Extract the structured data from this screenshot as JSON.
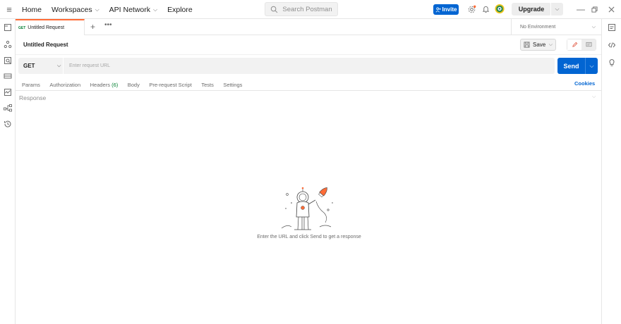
{
  "topbar": {
    "nav": [
      {
        "label": "Home",
        "has_chevron": false
      },
      {
        "label": "Workspaces",
        "has_chevron": true
      },
      {
        "label": "API Network",
        "has_chevron": true
      },
      {
        "label": "Explore",
        "has_chevron": false
      }
    ],
    "search_placeholder": "Search Postman",
    "invite_label": "Invite",
    "upgrade_label": "Upgrade",
    "brand_color": "#ff6c37",
    "accent_color": "#0265d2"
  },
  "tabs": {
    "items": [
      {
        "method": "GET",
        "title": "Untitled Request",
        "active": true
      }
    ],
    "environment": "No Environment"
  },
  "request": {
    "title": "Untitled Request",
    "save_label": "Save",
    "method": "GET",
    "url_placeholder": "Enter request URL",
    "url_value": "",
    "send_label": "Send",
    "subtabs": [
      {
        "label": "Params",
        "count": ""
      },
      {
        "label": "Authorization",
        "count": ""
      },
      {
        "label": "Headers",
        "count": "(6)"
      },
      {
        "label": "Body",
        "count": ""
      },
      {
        "label": "Pre-request Script",
        "count": ""
      },
      {
        "label": "Tests",
        "count": ""
      },
      {
        "label": "Settings",
        "count": ""
      }
    ],
    "cookies_label": "Cookies"
  },
  "response": {
    "label": "Response",
    "empty_message": "Enter the URL and click Send to get a response"
  },
  "icons": {
    "left_sidebar": [
      "collections-icon",
      "apis-icon",
      "environments-icon",
      "mock-servers-icon",
      "monitors-icon",
      "flows-icon",
      "history-icon"
    ],
    "right_sidebar": [
      "documentation-icon",
      "code-icon",
      "info-icon"
    ]
  }
}
